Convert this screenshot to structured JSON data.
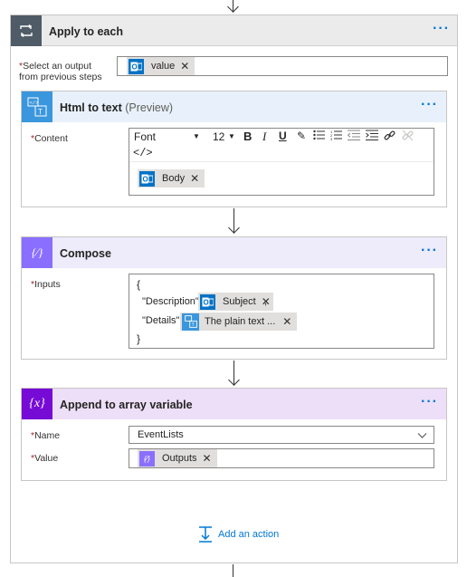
{
  "apply_each": {
    "title": "Apply to each",
    "select_label": "Select an output from previous steps",
    "select_token": "value"
  },
  "html_to_text": {
    "title": "Html to text",
    "preview": "(Preview)",
    "content_label": "Content",
    "toolbar": {
      "font": "Font",
      "size": "12",
      "bold": "B",
      "italic": "I",
      "underline": "U",
      "code": "</>"
    },
    "content_token": "Body"
  },
  "compose": {
    "title": "Compose",
    "inputs_label": "Inputs",
    "open_brace": "{",
    "close_brace": "}",
    "description_key": "\"Description\":",
    "description_token": "Subject",
    "comma": ",",
    "details_key": "\"Details\":",
    "details_token": "The plain text ..."
  },
  "append": {
    "title": "Append to array variable",
    "name_label": "Name",
    "name_value": "EventLists",
    "value_label": "Value",
    "value_token": "Outputs"
  },
  "add_action": "Add an action",
  "colors": {
    "loop": "#4f5b66",
    "html_to_text": "#3a96dd",
    "compose": "#8a6fff",
    "variable": "#770bd6",
    "outlook": "#0072c6",
    "accent": "#0078d4"
  }
}
